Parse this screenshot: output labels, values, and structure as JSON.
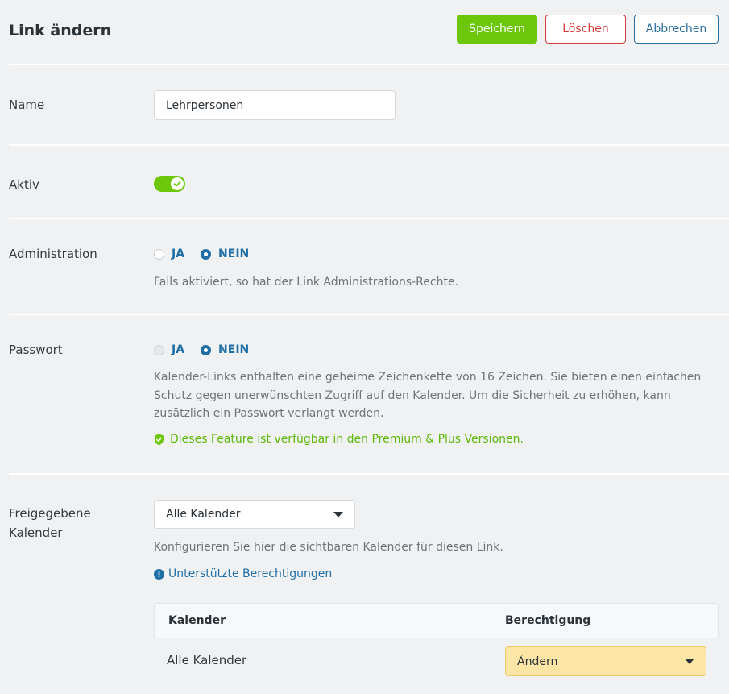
{
  "header": {
    "title": "Link ändern",
    "save_label": "Speichern",
    "delete_label": "Löschen",
    "cancel_label": "Abbrechen"
  },
  "name": {
    "label": "Name",
    "value": "Lehrpersonen"
  },
  "active": {
    "label": "Aktiv",
    "enabled": true
  },
  "administration": {
    "label": "Administration",
    "yes_label": "JA",
    "no_label": "NEIN",
    "selected": "NEIN",
    "help": "Falls aktiviert, so hat der Link Administrations-Rechte."
  },
  "password": {
    "label": "Passwort",
    "yes_label": "JA",
    "no_label": "NEIN",
    "selected": "NEIN",
    "help_line1": "Kalender-Links enthalten eine geheime Zeichenkette von 16 Zeichen. Sie bieten einen einfachen",
    "help_line2": "Schutz gegen unerwünschten Zugriff auf den Kalender. Um die Sicherheit zu erhöhen, kann",
    "help_line3": "zusätzlich ein Passwort verlangt werden.",
    "feature_note": "Dieses Feature ist verfügbar in den Premium & Plus Versionen."
  },
  "calendars": {
    "label_line1": "Freigegebene",
    "label_line2": "Kalender",
    "select_value": "Alle Kalender",
    "help": "Konfigurieren Sie hier die sichtbaren Kalender für diesen Link.",
    "permissions_link": "Unterstützte Berechtigungen",
    "table": {
      "col_calendar": "Kalender",
      "col_permission": "Berechtigung",
      "rows": [
        {
          "calendar": "Alle Kalender",
          "permission": "Ändern"
        }
      ]
    }
  },
  "colors": {
    "accent_green": "#6cc70a",
    "danger_red": "#d33a3a",
    "primary_blue": "#1f6ea6",
    "permission_highlight": "#fde6a5"
  }
}
